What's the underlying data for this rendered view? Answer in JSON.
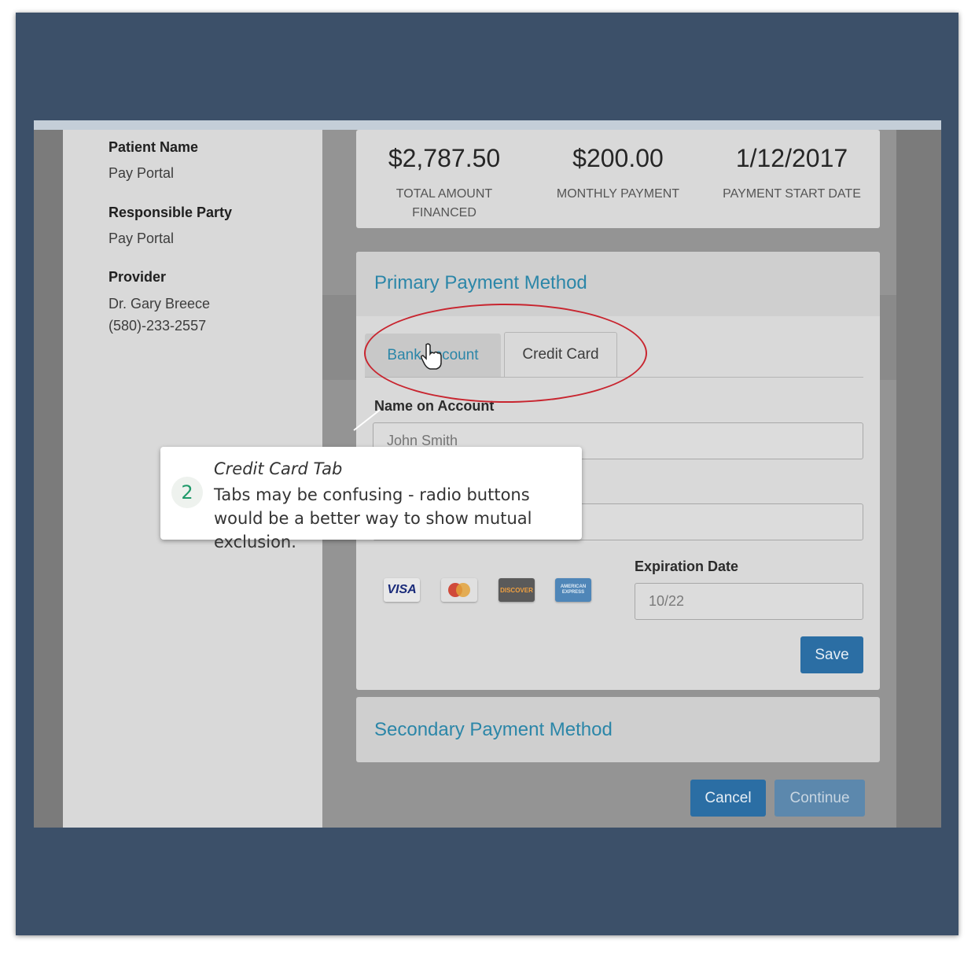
{
  "sidebar": {
    "patient_name_label": "Patient Name",
    "patient_name_value": "Pay Portal",
    "responsible_party_label": "Responsible Party",
    "responsible_party_value": "Pay Portal",
    "provider_label": "Provider",
    "provider_name": "Dr. Gary Breece",
    "provider_phone": "(580)-233-2557"
  },
  "summary": {
    "total_amount": "$2,787.50",
    "total_amount_label_line1": "TOTAL AMOUNT",
    "total_amount_label_line2": "FINANCED",
    "monthly_payment": "$200.00",
    "monthly_payment_label": "MONTHLY PAYMENT",
    "start_date": "1/12/2017",
    "start_date_label": "PAYMENT START DATE"
  },
  "primary": {
    "title": "Primary Payment Method",
    "tab_bank": "Bank Account",
    "tab_credit_card": "Credit Card",
    "name_label": "Name on Account",
    "name_placeholder": "John Smith",
    "expiration_label": "Expiration Date",
    "expiration_value": "10/22",
    "save_label": "Save",
    "card_logos": [
      "VISA",
      "MasterCard",
      "DISCOVER",
      "AMERICAN EXPRESS"
    ]
  },
  "secondary": {
    "title": "Secondary Payment Method"
  },
  "footer": {
    "cancel_label": "Cancel",
    "continue_label": "Continue"
  },
  "annotation": {
    "number": "2",
    "title": "Credit Card Tab",
    "text": "Tabs may be confusing - radio buttons would be a better way to show mutual exclusion."
  },
  "colors": {
    "frame": "#3c5069",
    "link": "#2b86a8",
    "primary_button": "#2b6ea4",
    "highlight": "#c8252f",
    "badge": "#1f9a6a"
  }
}
